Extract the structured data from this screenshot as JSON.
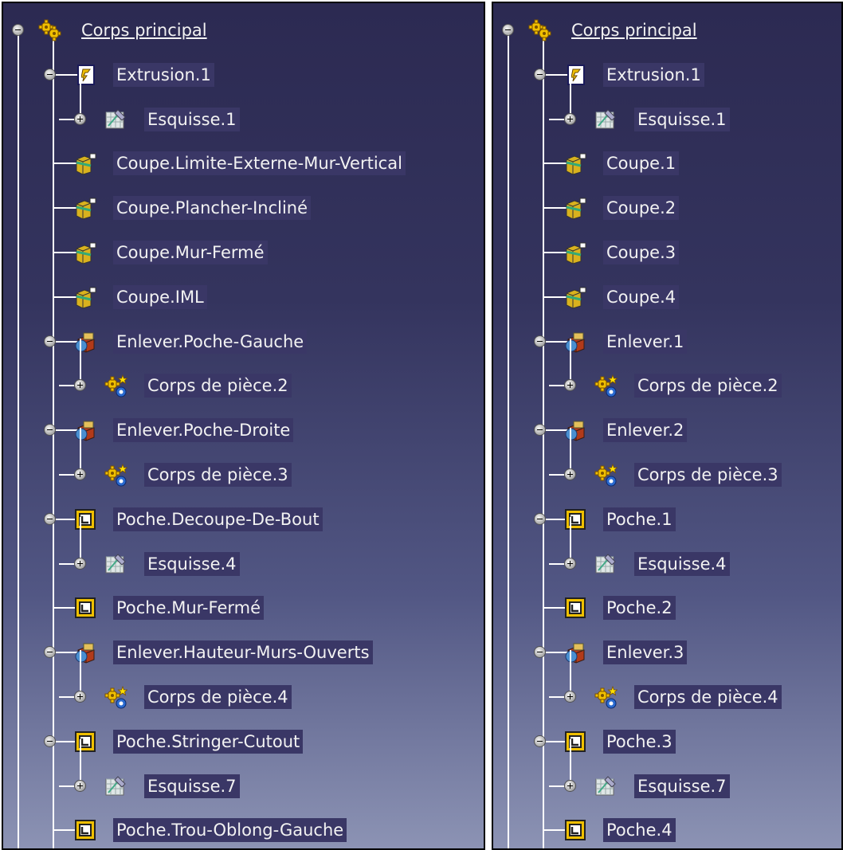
{
  "panels": [
    {
      "root": "Corps principal",
      "nodes": [
        {
          "label": "Extrusion.1",
          "icon": "extrusion-icon",
          "expander": "minus"
        },
        {
          "label": "Esquisse.1",
          "icon": "sketch-icon",
          "expander": "plus"
        },
        {
          "label": "Coupe.Limite-Externe-Mur-Vertical",
          "icon": "split-icon"
        },
        {
          "label": "Coupe.Plancher-Incliné",
          "icon": "split-icon"
        },
        {
          "label": "Coupe.Mur-Fermé",
          "icon": "split-icon"
        },
        {
          "label": "Coupe.IML",
          "icon": "split-icon"
        },
        {
          "label": "Enlever.Poche-Gauche",
          "icon": "remove-icon",
          "expander": "minus"
        },
        {
          "label": "Corps de pièce.2",
          "icon": "body-icon",
          "expander": "plus"
        },
        {
          "label": "Enlever.Poche-Droite",
          "icon": "remove-icon",
          "expander": "minus"
        },
        {
          "label": "Corps de pièce.3",
          "icon": "body-icon",
          "expander": "plus"
        },
        {
          "label": "Poche.Decoupe-De-Bout",
          "icon": "pocket-icon",
          "expander": "minus"
        },
        {
          "label": "Esquisse.4",
          "icon": "sketch-icon",
          "expander": "plus"
        },
        {
          "label": "Poche.Mur-Fermé",
          "icon": "pocket-icon"
        },
        {
          "label": "Enlever.Hauteur-Murs-Ouverts",
          "icon": "remove-icon",
          "expander": "minus"
        },
        {
          "label": "Corps de pièce.4",
          "icon": "body-icon",
          "expander": "plus"
        },
        {
          "label": "Poche.Stringer-Cutout",
          "icon": "pocket-icon",
          "expander": "minus"
        },
        {
          "label": "Esquisse.7",
          "icon": "sketch-icon",
          "expander": "plus"
        },
        {
          "label": "Poche.Trou-Oblong-Gauche",
          "icon": "pocket-icon"
        }
      ]
    },
    {
      "root": "Corps principal",
      "nodes": [
        {
          "label": "Extrusion.1",
          "icon": "extrusion-icon",
          "expander": "minus"
        },
        {
          "label": "Esquisse.1",
          "icon": "sketch-icon",
          "expander": "plus"
        },
        {
          "label": "Coupe.1",
          "icon": "split-icon"
        },
        {
          "label": "Coupe.2",
          "icon": "split-icon"
        },
        {
          "label": "Coupe.3",
          "icon": "split-icon"
        },
        {
          "label": "Coupe.4",
          "icon": "split-icon"
        },
        {
          "label": "Enlever.1",
          "icon": "remove-icon",
          "expander": "minus"
        },
        {
          "label": "Corps de pièce.2",
          "icon": "body-icon",
          "expander": "plus"
        },
        {
          "label": "Enlever.2",
          "icon": "remove-icon",
          "expander": "minus"
        },
        {
          "label": "Corps de pièce.3",
          "icon": "body-icon",
          "expander": "plus"
        },
        {
          "label": "Poche.1",
          "icon": "pocket-icon",
          "expander": "minus"
        },
        {
          "label": "Esquisse.4",
          "icon": "sketch-icon",
          "expander": "plus"
        },
        {
          "label": "Poche.2",
          "icon": "pocket-icon"
        },
        {
          "label": "Enlever.3",
          "icon": "remove-icon",
          "expander": "minus"
        },
        {
          "label": "Corps de pièce.4",
          "icon": "body-icon",
          "expander": "plus"
        },
        {
          "label": "Poche.3",
          "icon": "pocket-icon",
          "expander": "minus"
        },
        {
          "label": "Esquisse.7",
          "icon": "sketch-icon",
          "expander": "plus"
        },
        {
          "label": "Poche.4",
          "icon": "pocket-icon"
        }
      ]
    }
  ]
}
